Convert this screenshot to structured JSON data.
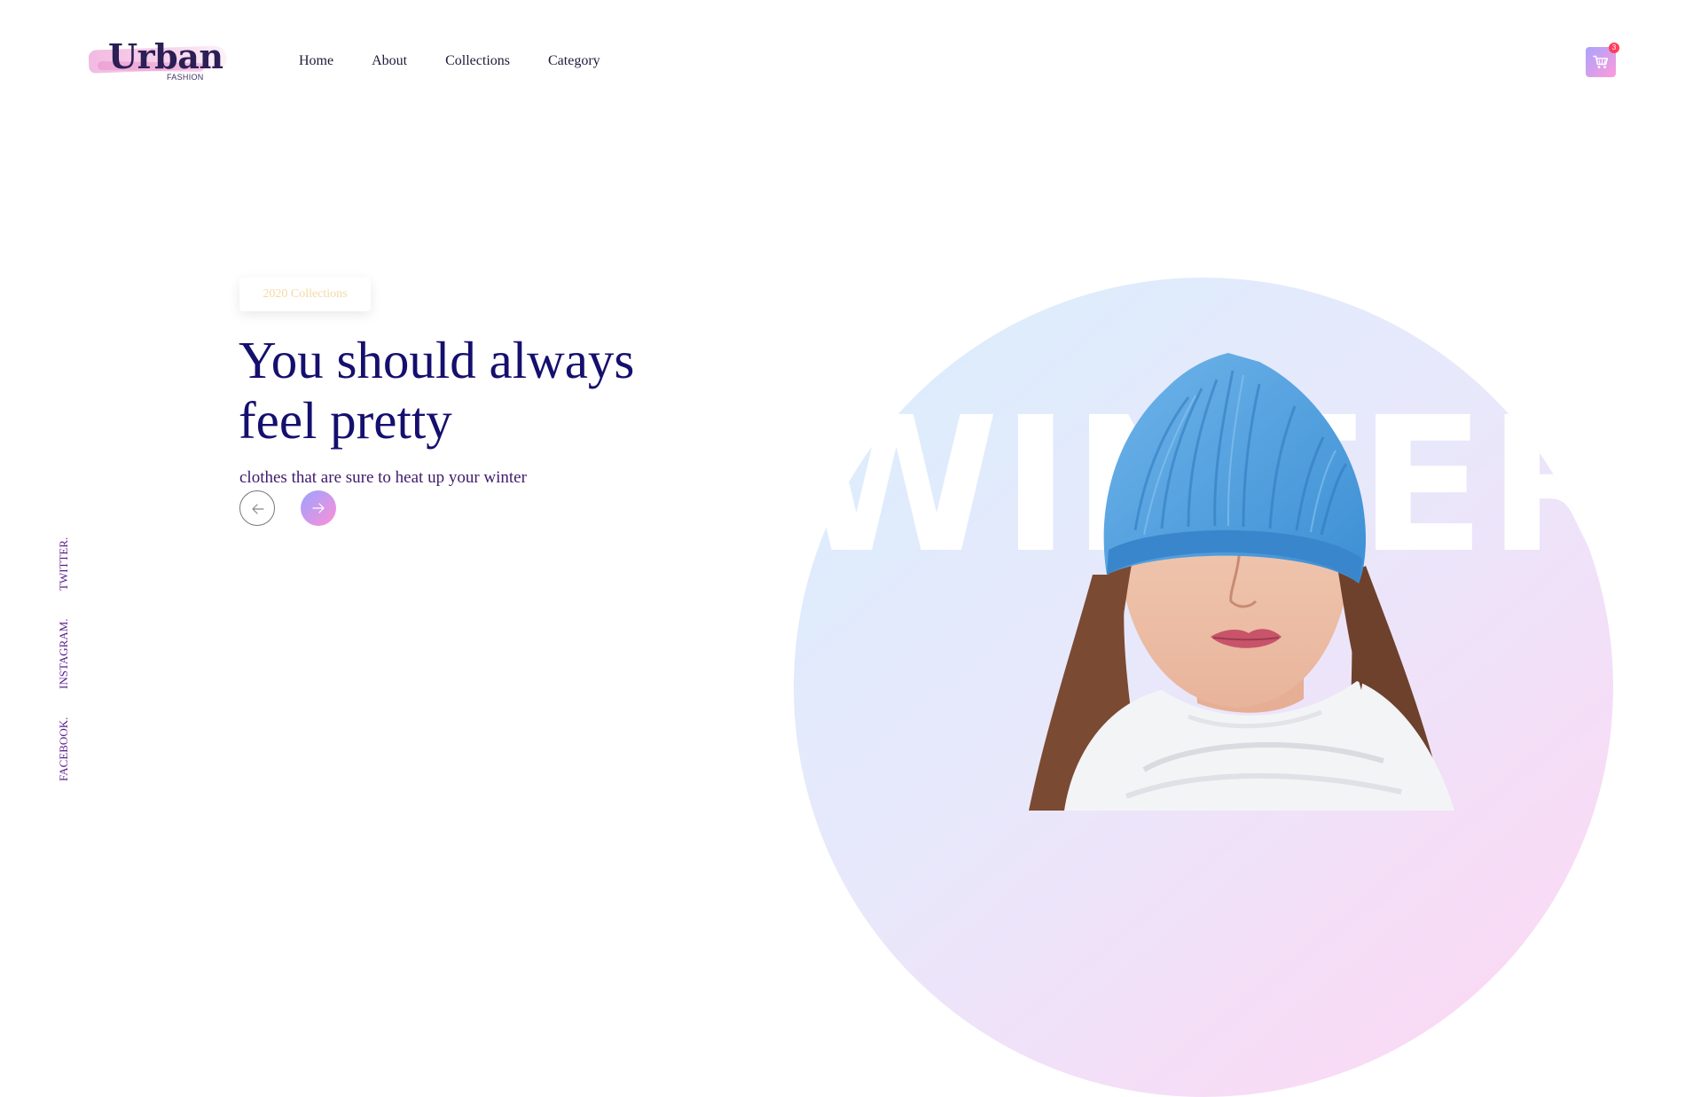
{
  "brand": {
    "name": "Urban",
    "tagline": "FASHION"
  },
  "nav": {
    "items": [
      "Home",
      "About",
      "Collections",
      "Category"
    ]
  },
  "cart": {
    "count": "3",
    "icon": "cart-icon"
  },
  "hero": {
    "tag": "2020 Collections",
    "headline": "You should always feel pretty",
    "subline": "clothes that are sure to heat up your winter",
    "background_word": "WINTER",
    "prev_icon": "arrow-left-icon",
    "next_icon": "arrow-right-icon"
  },
  "social": [
    "TWITTER.",
    "INSTAGRAM.",
    "FACEBOOK."
  ],
  "colors": {
    "headline": "#150f6e",
    "accent_gradient_start": "#9aa3ff",
    "accent_gradient_end": "#ff8fd6",
    "tag_text": "#f5d8a4",
    "social": "#5b1b8a"
  }
}
